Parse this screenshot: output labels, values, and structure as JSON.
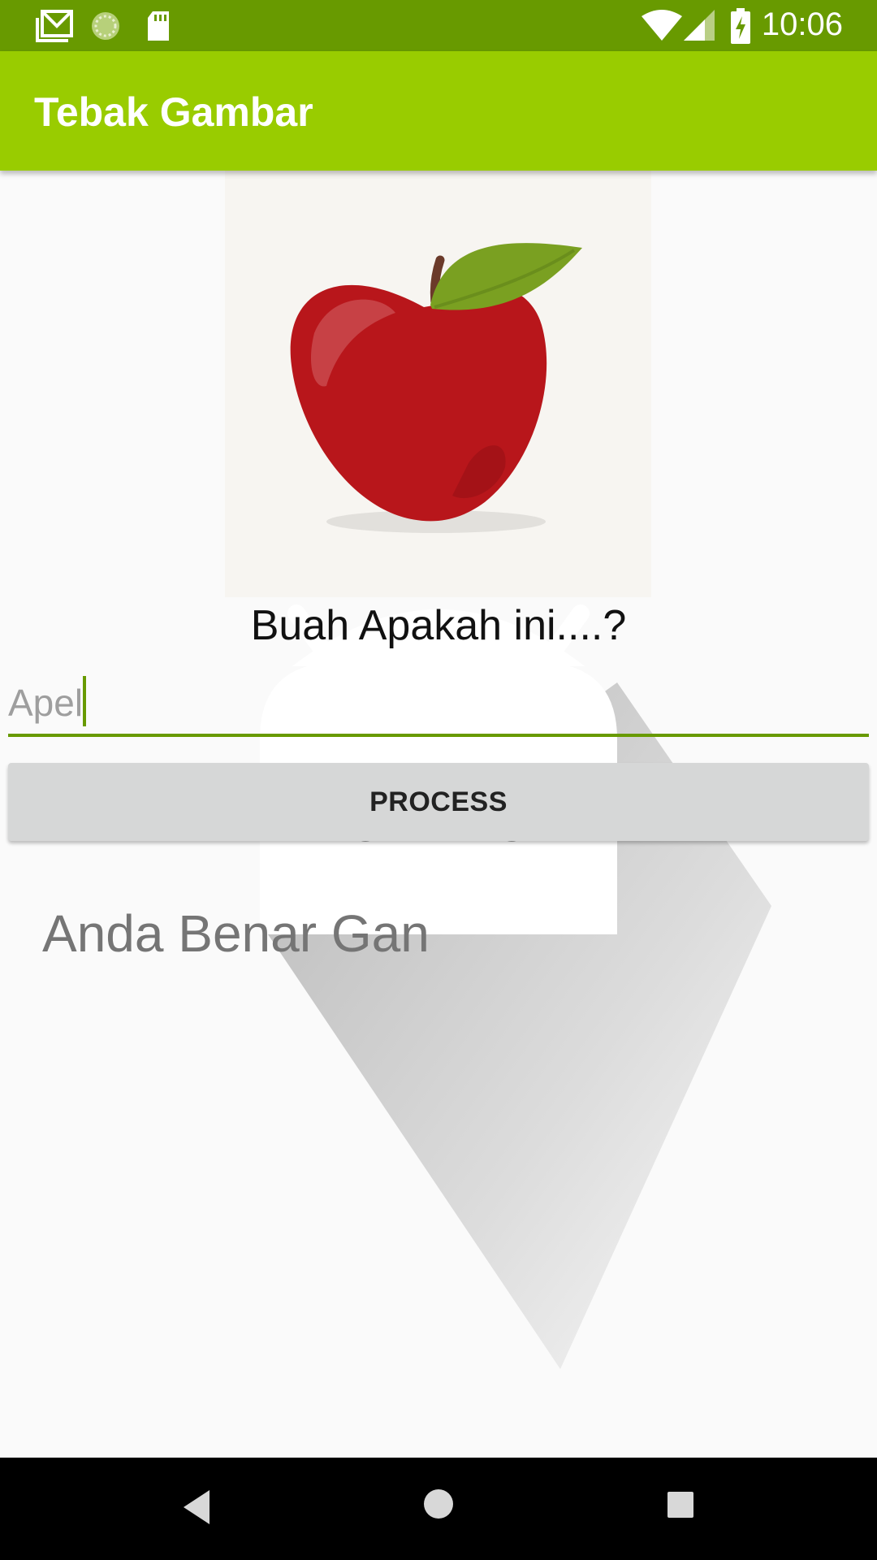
{
  "status_bar": {
    "time": "10:06",
    "icons_left": [
      "gmail-icon",
      "sync-icon",
      "sd-card-icon"
    ],
    "icons_right": [
      "wifi-icon",
      "signal-icon",
      "battery-charging-icon"
    ]
  },
  "app_bar": {
    "title": "Tebak Gambar"
  },
  "main": {
    "image": "apple-image",
    "question": "Buah Apakah ini....?",
    "answer_value": "Apel",
    "process_label": "PROCESS",
    "result": "Anda Benar Gan"
  },
  "nav_bar": {
    "buttons": [
      "back-icon",
      "home-icon",
      "recents-icon"
    ]
  },
  "colors": {
    "status_bar": "#689a00",
    "app_bar": "#99cc00",
    "accent": "#689a00",
    "button": "#d6d7d7"
  }
}
